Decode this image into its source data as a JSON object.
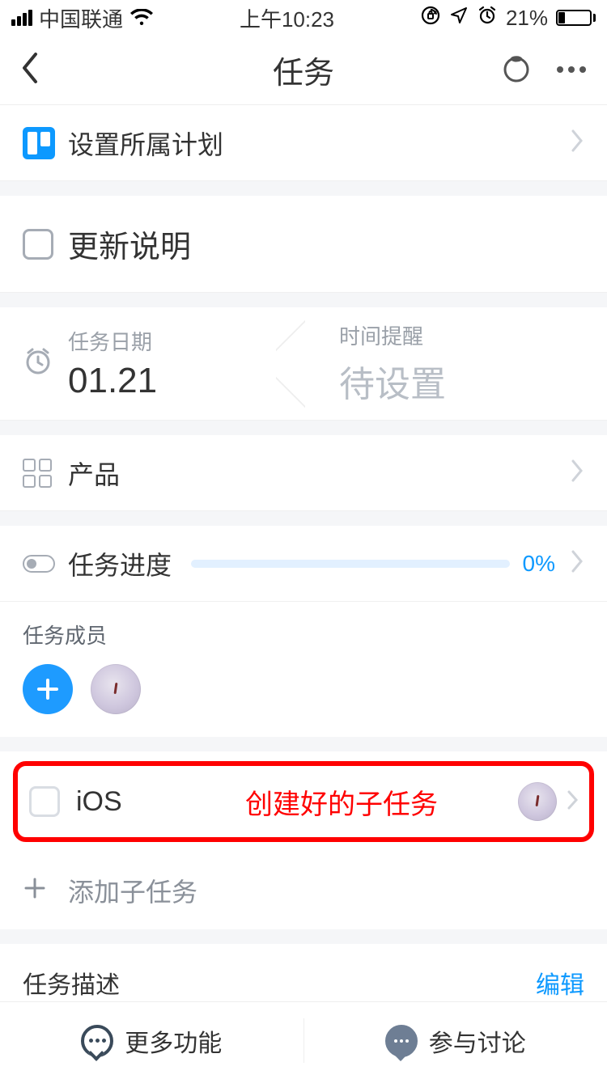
{
  "status": {
    "carrier": "中国联通",
    "time": "上午10:23",
    "battery_pct": "21%"
  },
  "nav": {
    "title": "任务"
  },
  "rows": {
    "plan_label": "设置所属计划",
    "task_title": "更新说明",
    "date_label": "任务日期",
    "date_value": "01.21",
    "reminder_label": "时间提醒",
    "reminder_value": "待设置",
    "category_label": "产品",
    "progress_label": "任务进度",
    "progress_value": "0%"
  },
  "members": {
    "section_label": "任务成员"
  },
  "subtask": {
    "name": "iOS",
    "annotation": "创建好的子任务",
    "add_label": "添加子任务"
  },
  "description": {
    "label": "任务描述",
    "edit": "编辑"
  },
  "bottom": {
    "more": "更多功能",
    "discuss": "参与讨论"
  }
}
